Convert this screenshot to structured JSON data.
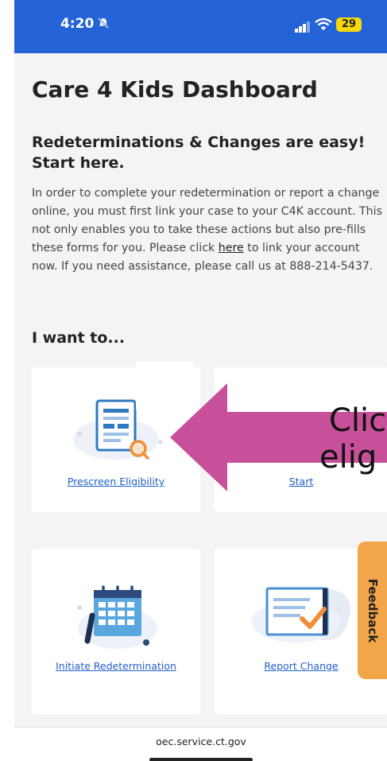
{
  "status_bar": {
    "time": "4:20",
    "battery": "29",
    "icons": [
      "silent-bell-icon",
      "signal-icon",
      "wifi-icon",
      "battery-icon"
    ]
  },
  "page": {
    "title": "Care 4 Kids Dashboard",
    "subtitle": "Redeterminations & Changes are easy! Start here.",
    "intro_before_link": "In order to complete your redetermination or report a change online, you must first link your case to your C4K account. This not only enables you to take these actions but also pre-fills these forms for you. Please click ",
    "intro_link": "here",
    "intro_after_link": " to link your account now. If you need assistance, please call us at 888-214-5437.",
    "section_heading": "I want to..."
  },
  "cards": [
    {
      "label": "Prescreen Eligibility",
      "icon": "document-search-icon"
    },
    {
      "label": "Start",
      "icon": "application-icon"
    },
    {
      "label": "Initiate Redetermination",
      "icon": "calendar-icon"
    },
    {
      "label": "Report Change",
      "icon": "checklist-icon"
    }
  ],
  "callout": {
    "line1": "Clic",
    "line2": "elig",
    "color": "#c8509a"
  },
  "feedback": {
    "label": "Feedback",
    "color": "#f3a54a"
  },
  "browser": {
    "url": "oec.service.ct.gov"
  },
  "colors": {
    "accent": "#2463d6",
    "link": "#1f5fc8"
  }
}
